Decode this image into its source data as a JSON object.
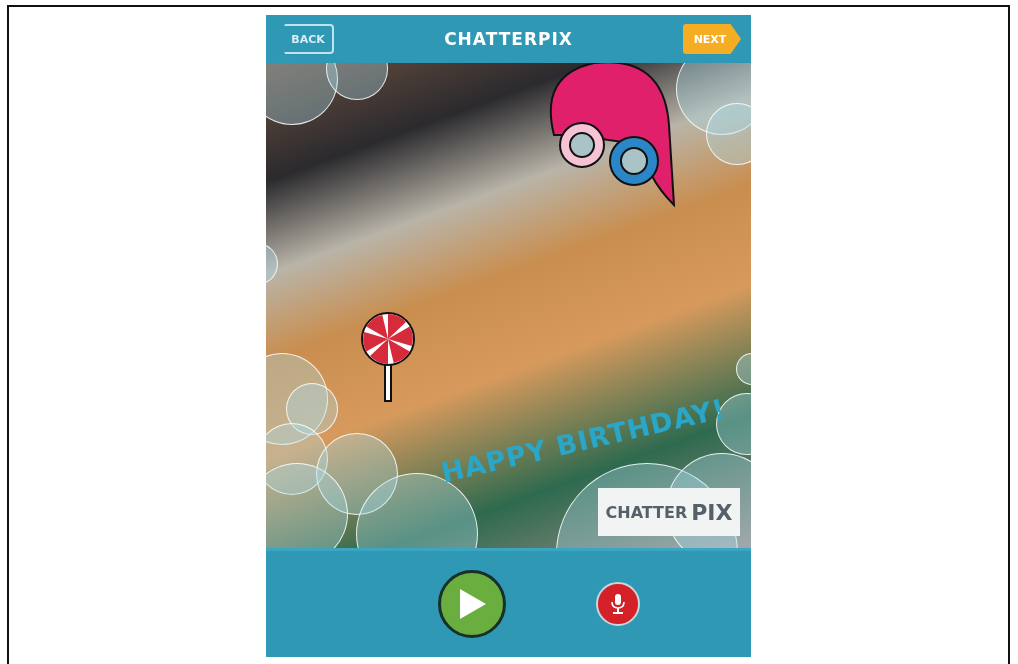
{
  "header": {
    "back": "BACK",
    "title": "CHATTERPIX",
    "next": "NEXT"
  },
  "stickers": [
    {
      "kind": "text",
      "text": "HAPPY BIRTHDAY!"
    },
    {
      "kind": "lollipop"
    },
    {
      "kind": "hat-glasses"
    }
  ],
  "stamp": {
    "left": "CHATTER",
    "right": "PIX"
  }
}
